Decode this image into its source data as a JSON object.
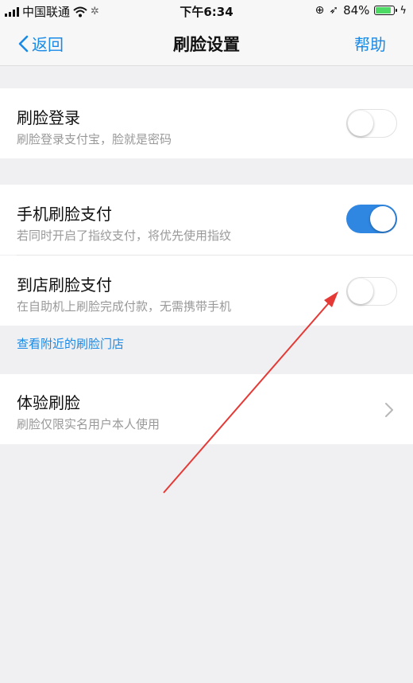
{
  "status_bar": {
    "carrier": "中国联通",
    "time": "下午6:34",
    "battery": "84%"
  },
  "nav": {
    "back_label": "返回",
    "title": "刷脸设置",
    "help_label": "帮助"
  },
  "settings": {
    "face_login": {
      "title": "刷脸登录",
      "subtitle": "刷脸登录支付宝，脸就是密码",
      "enabled": false
    },
    "phone_face_pay": {
      "title": "手机刷脸支付",
      "subtitle": "若同时开启了指纹支付，将优先使用指纹",
      "enabled": true
    },
    "store_face_pay": {
      "title": "到店刷脸支付",
      "subtitle": "在自助机上刷脸完成付款，无需携带手机",
      "enabled": false
    },
    "nearby_link": "查看附近的刷脸门店",
    "try_face": {
      "title": "体验刷脸",
      "subtitle": "刷脸仅限实名用户本人使用"
    }
  },
  "colors": {
    "accent": "#1a8ae6",
    "toggle_on": "#2f87e2",
    "annotation_arrow": "#e53935"
  }
}
